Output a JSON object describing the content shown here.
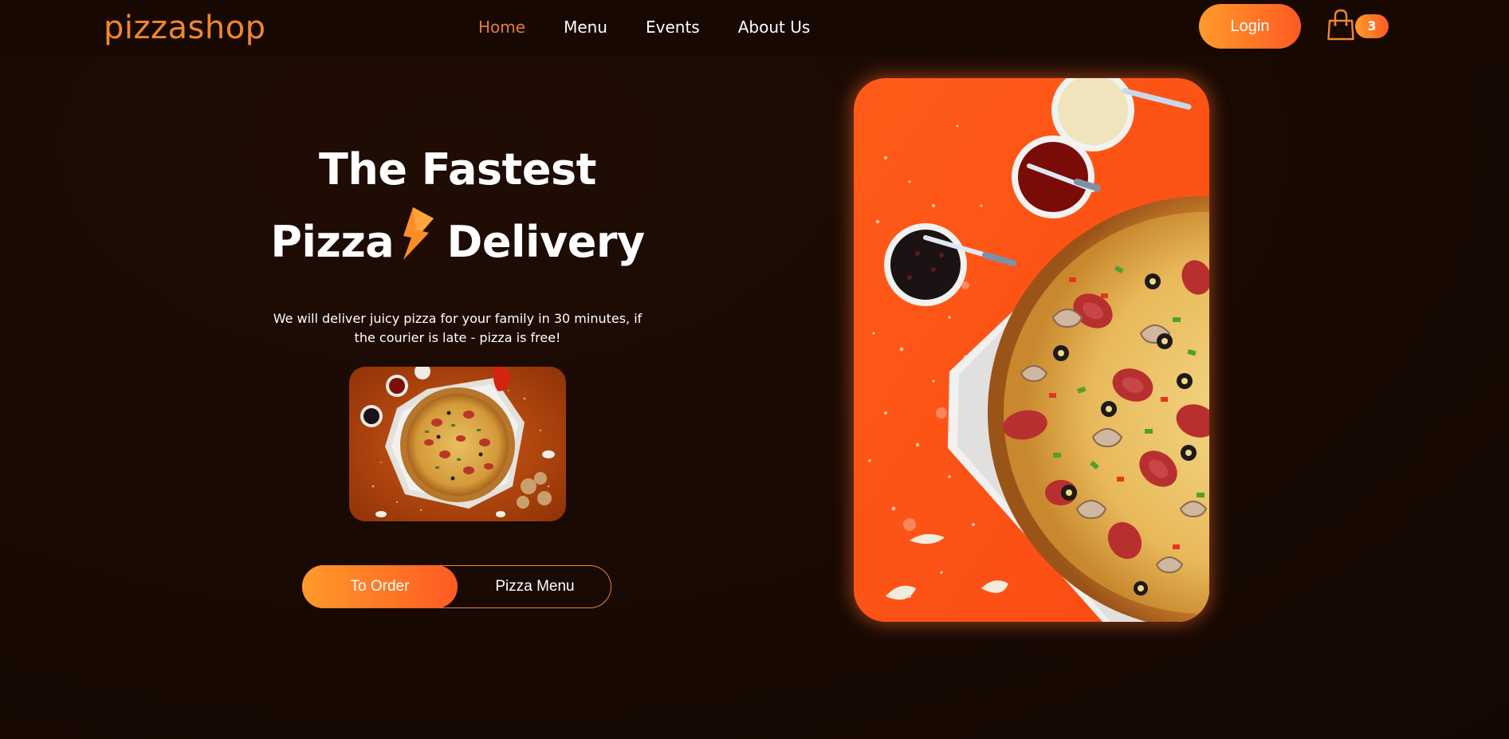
{
  "header": {
    "logo": "pizzashop",
    "nav": [
      {
        "label": "Home",
        "active": true
      },
      {
        "label": "Menu",
        "active": false
      },
      {
        "label": "Events",
        "active": false
      },
      {
        "label": "About Us",
        "active": false
      }
    ],
    "login_label": "Login",
    "cart_icon": "shopping-bag-icon",
    "cart_count": "3"
  },
  "hero": {
    "title_line1": "The Fastest",
    "title_line2_word1": "Pizza",
    "title_line2_word2": "Delivery",
    "title_icon": "lightning-bolt-icon",
    "description": "We will deliver juicy pizza for your family in 30 minutes, if the courier is late - pizza is free!",
    "order_label": "To Order",
    "menu_label": "Pizza Menu"
  },
  "colors": {
    "background": "#1c0b04",
    "accent": "#f0862f",
    "accent_gradient_start": "#ff9a2a",
    "accent_gradient_end": "#ff5a23",
    "nav_active": "#e7793a",
    "photo_background": "#fe5618"
  }
}
